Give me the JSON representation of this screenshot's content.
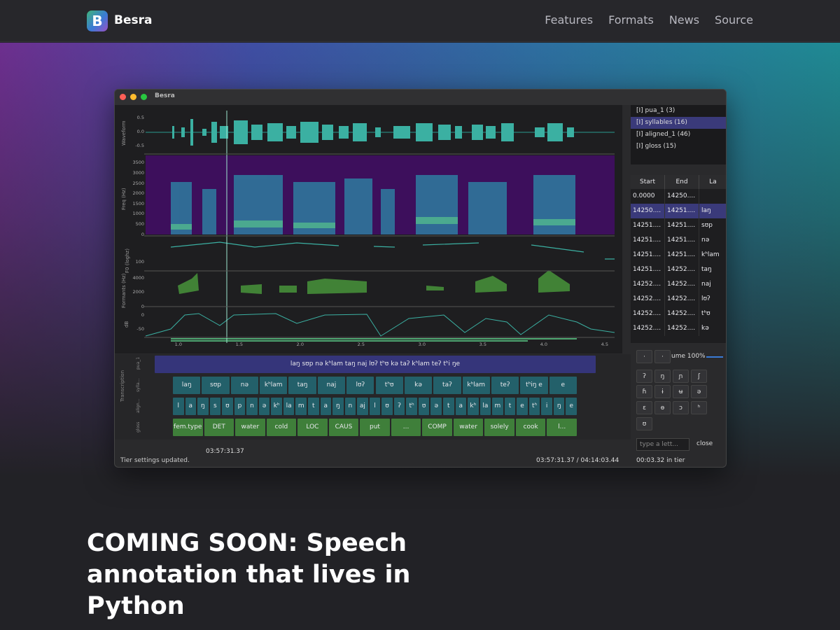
{
  "site": {
    "brand": "Besra",
    "logo_letter": "B",
    "nav": [
      "Features",
      "Formats",
      "News",
      "Source"
    ]
  },
  "window": {
    "title": "Besra"
  },
  "plots": {
    "labels": [
      "Waveform",
      "Freq (Hz)",
      "F0 (loghz)",
      "Formants (Hz)",
      "dB"
    ],
    "wave_ticks": [
      "0.5",
      "0.0",
      "-0.5"
    ],
    "spec_ticks": [
      "3500",
      "3000",
      "2500",
      "2000",
      "1500",
      "1000",
      "500",
      "0"
    ],
    "f0_ticks": [
      "100"
    ],
    "form_ticks": [
      "4000",
      "2000",
      "0"
    ],
    "db_ticks": [
      "0",
      "-50"
    ],
    "x_ticks": [
      "1.0",
      "1.5",
      "2.0",
      "2.5",
      "3.0",
      "3.5",
      "4.0",
      "4.5"
    ]
  },
  "tiers": [
    "[I] pua_1  (3)",
    "[I] syllables  (16)",
    "[I] aligned_1  (46)",
    "[I] gloss  (15)"
  ],
  "table": {
    "headers": [
      "Start",
      "End",
      "La"
    ],
    "rows": [
      [
        "0.0000",
        "14250....",
        ""
      ],
      [
        "14250....",
        "14251....",
        "laŋ"
      ],
      [
        "14251....",
        "14251....",
        "sʊp"
      ],
      [
        "14251....",
        "14251....",
        "nə"
      ],
      [
        "14251....",
        "14251....",
        "kʰlam"
      ],
      [
        "14251....",
        "14252....",
        "taŋ"
      ],
      [
        "14252....",
        "14252....",
        "naj"
      ],
      [
        "14252....",
        "14252....",
        "lʊʔ"
      ],
      [
        "14252....",
        "14252....",
        "tʰʊ"
      ],
      [
        "14252....",
        "14252....",
        "kə"
      ]
    ]
  },
  "annotation": {
    "row_labels": [
      "pua_1",
      "sylla...",
      "align...",
      "gloss"
    ],
    "group_label": "Transcription",
    "pua": "laŋ sʊp nə kʰlam taŋ naj lʊʔ tʰʊ kə taʔ kʰlam teʔ tʰi ŋe",
    "syllables": [
      "laŋ",
      "sʊp",
      "nə",
      "kʰlam",
      "taŋ",
      "naj",
      "lʊʔ",
      "tʰʊ",
      "kə",
      "taʔ",
      "kʰlam",
      "teʔ",
      "tʰiŋ e",
      "e"
    ],
    "aligned": [
      "l",
      "a",
      "ŋ",
      "s",
      "ʊ",
      "p",
      "n",
      "ə",
      "kʰ",
      "la",
      "m",
      "t",
      "a",
      "ŋ",
      "n",
      "aj",
      "l",
      "ʊ",
      "ʔ",
      "tʰ",
      "ʊ",
      "ə",
      "t",
      "a",
      "kʰ",
      "la",
      "m",
      "t",
      "e",
      "tʰ",
      "i",
      "ŋ",
      "e"
    ],
    "gloss": [
      "fem.type",
      "DET",
      "water",
      "cold",
      "LOC",
      "CAUS",
      "put",
      "...",
      "COMP",
      "water",
      "solely",
      "cook",
      "l..."
    ]
  },
  "keyboard": {
    "volume_label": "ume 100%",
    "keys": [
      "·",
      "·",
      "ʔ",
      "ŋ",
      "ɲ",
      "ʃ",
      "ɦ",
      "ɨ",
      "ʉ",
      "ə",
      "ɛ",
      "ɵ",
      "ɔ",
      "ʰ",
      "ʊ"
    ],
    "input_placeholder": "type a lett...",
    "close_label": "close"
  },
  "status": {
    "message": "Tier settings updated.",
    "cursor_time": "03:57:31.37",
    "position": "03:57:31.37 / 04:14:03.44",
    "tier_time": "00:03.32 in tier"
  },
  "headline": "COMING SOON: Speech annotation that lives in Python"
}
